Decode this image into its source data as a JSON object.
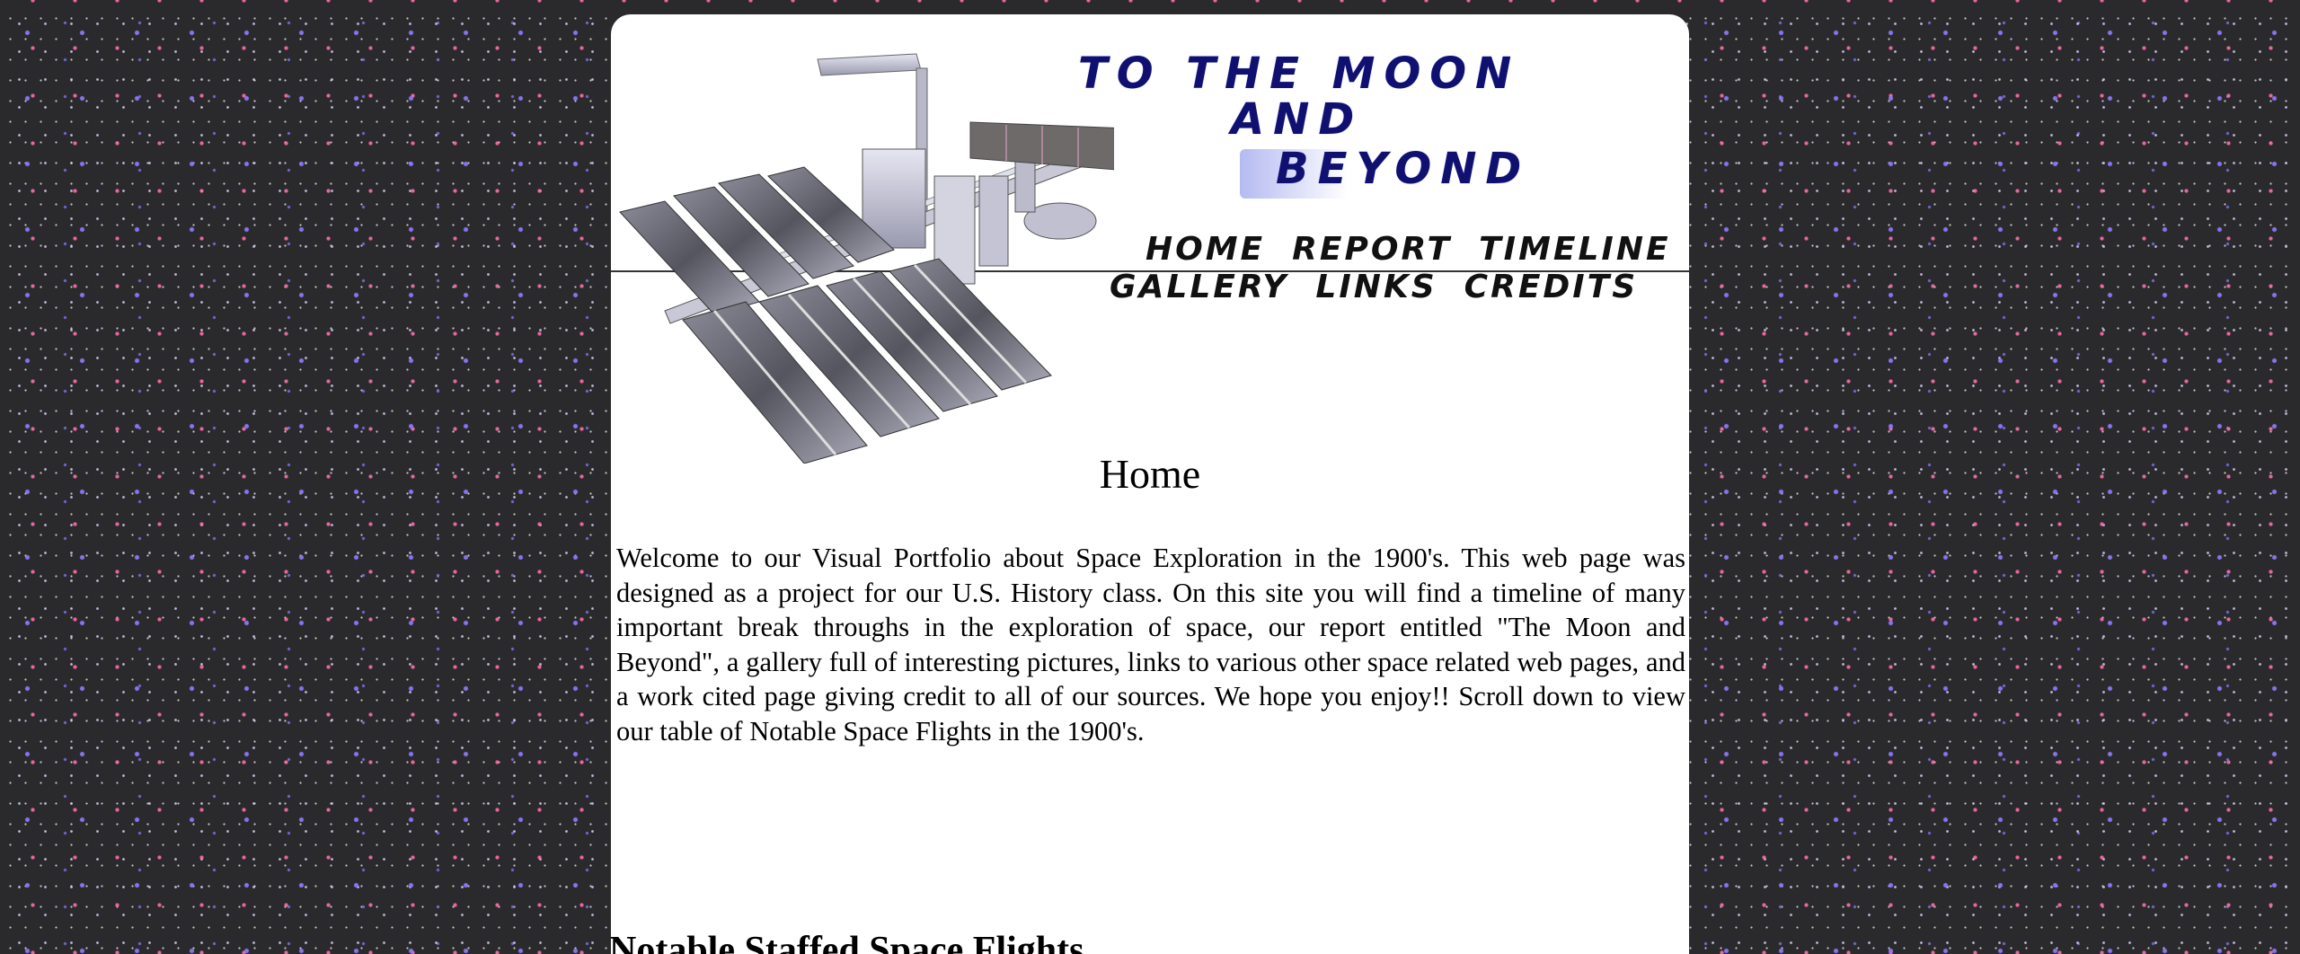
{
  "header": {
    "title_lines": [
      "To the Moon",
      "and",
      "Beyond"
    ],
    "nav": {
      "home": "Home",
      "report": "Report",
      "timeline": "Timeline",
      "gallery": "Gallery",
      "links": "Links",
      "credits": "Credits"
    }
  },
  "main": {
    "heading": "Home",
    "intro": "Welcome to our Visual Portfolio about Space Exploration in the 1900's. This web page was designed as a project for our U.S. History class. On this site you will find a timeline of many important break throughs in the exploration of space, our report entitled \"The Moon and Beyond\", a gallery full of interesting pictures, links to various other space related web pages, and a work cited page giving credit to all of our sources. We hope you enjoy!! Scroll down to view our table of Notable Space Flights in the 1900's.",
    "table_heading": "Notable Staffed Space Flights"
  },
  "colors": {
    "background": "#2a2a2c",
    "panel": "#ffffff",
    "title": "#101070",
    "text": "#000000"
  },
  "icons": {
    "header_image": "space-station-illustration"
  }
}
